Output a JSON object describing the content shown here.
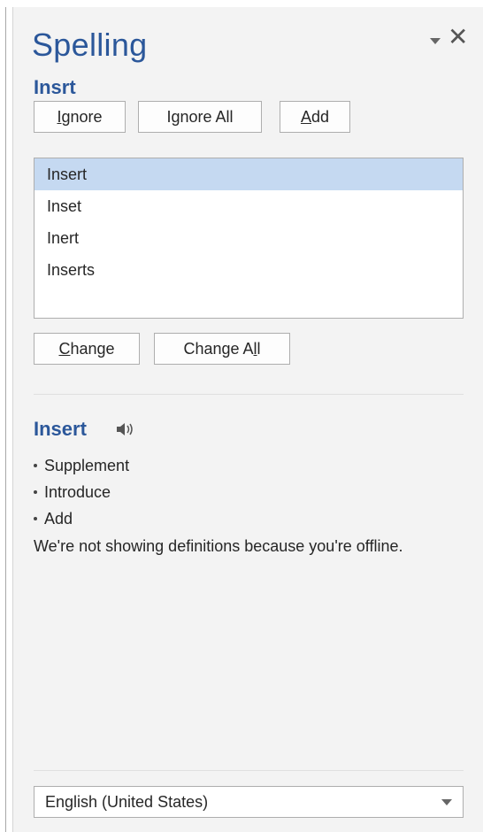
{
  "pane": {
    "title": "Spelling",
    "close_glyph": "✕",
    "menu_icon": "chevron-down-icon"
  },
  "error_word": "Insrt",
  "buttons": {
    "ignore": {
      "accel": "I",
      "rest": "gnore"
    },
    "ignore_all": {
      "pre": "I",
      "accel": "g",
      "rest": "nore All"
    },
    "add": {
      "accel": "A",
      "rest": "dd"
    },
    "change": {
      "accel": "C",
      "rest": "hange"
    },
    "change_all": {
      "pre": "Change A",
      "accel": "l",
      "rest": "l"
    }
  },
  "suggestions": [
    "Insert",
    "Inset",
    "Inert",
    "Inserts"
  ],
  "selected_suggestion": "Insert",
  "definition": {
    "word": "Insert",
    "synonyms": [
      "Supplement",
      "Introduce",
      "Add"
    ],
    "offline_note": "We're not showing definitions because you're offline."
  },
  "language": {
    "selected": "English (United States)"
  },
  "colors": {
    "accent": "#2b579a",
    "selection": "#c5d9f1",
    "pane_bg": "#f3f3f3"
  }
}
